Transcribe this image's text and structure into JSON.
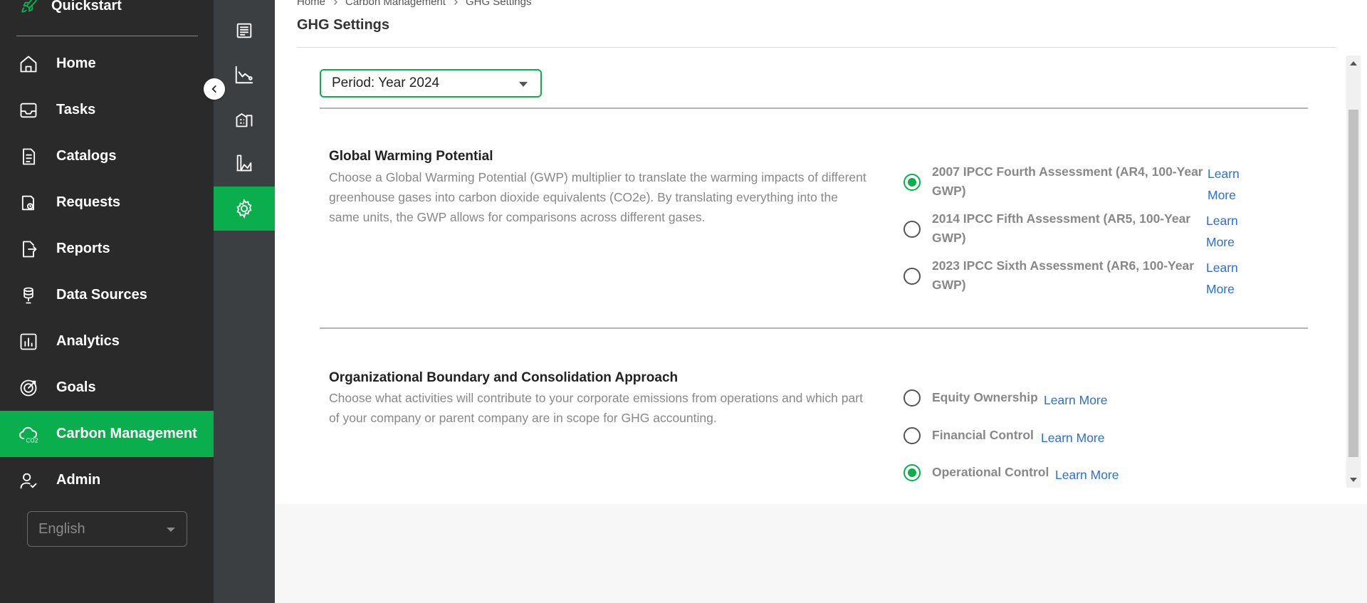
{
  "sidebar": {
    "quickstart": "Quickstart",
    "items": [
      {
        "label": "Home",
        "icon": "home-icon"
      },
      {
        "label": "Tasks",
        "icon": "inbox-icon"
      },
      {
        "label": "Catalogs",
        "icon": "document-icon"
      },
      {
        "label": "Requests",
        "icon": "requests-icon"
      },
      {
        "label": "Reports",
        "icon": "report-export-icon"
      },
      {
        "label": "Data Sources",
        "icon": "database-icon"
      },
      {
        "label": "Analytics",
        "icon": "bar-chart-icon"
      },
      {
        "label": "Goals",
        "icon": "target-icon"
      },
      {
        "label": "Carbon Management",
        "icon": "cloud-co2-icon"
      },
      {
        "label": "Admin",
        "icon": "user-admin-icon"
      }
    ],
    "active_item": "Carbon Management",
    "language": "English"
  },
  "subnav": {
    "items": [
      "ledger-icon",
      "chart-line-icon",
      "buildings-icon",
      "factory-icon",
      "settings-gear-icon"
    ],
    "active": "settings-gear-icon"
  },
  "breadcrumb": [
    "Home",
    "Carbon Management",
    "GHG Settings"
  ],
  "page_title": "GHG Settings",
  "period": {
    "label": "Period: Year 2024"
  },
  "gwp": {
    "title": "Global Warming Potential",
    "description": "Choose a Global Warming Potential (GWP) multiplier to translate the warming impacts of different greenhouse gases into carbon dioxide equivalents (CO2e). By translating everything into the same units, the GWP allows for comparisons across different gases.",
    "options": [
      {
        "line1": "2007 IPCC Fourth Assessment (AR4, 100-Year",
        "line2": "GWP)",
        "checked": true
      },
      {
        "line1": "2014 IPCC Fifth Assessment (AR5, 100-Year",
        "line2": "GWP)",
        "checked": false
      },
      {
        "line1": "2023 IPCC Sixth Assessment (AR6, 100-Year",
        "line2": "GWP)",
        "checked": false
      }
    ],
    "learn_line1": "Learn",
    "learn_line2": "More"
  },
  "boundary": {
    "title": "Organizational Boundary and Consolidation Approach",
    "description": "Choose what activities will contribute to your corporate emissions from operations and which part of your company or parent company are in scope for GHG accounting.",
    "options": [
      {
        "label": "Equity Ownership",
        "checked": false
      },
      {
        "label": "Financial Control",
        "checked": false
      },
      {
        "label": "Operational Control",
        "checked": true
      }
    ],
    "learn_more": "Learn More"
  },
  "colors": {
    "accent": "#0aae4c",
    "sidebar": "#2a2a2a",
    "subnav": "#3c3f42",
    "link": "#2a6fdb"
  }
}
